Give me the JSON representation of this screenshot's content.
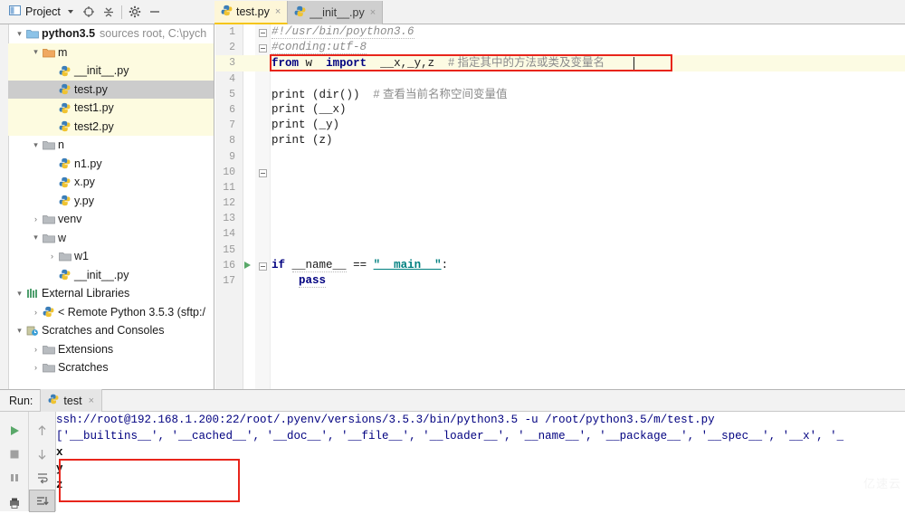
{
  "toolbar": {
    "project_label": "Project",
    "icons": [
      "target-icon",
      "collapse-all-icon",
      "gear-icon",
      "minimize-icon"
    ]
  },
  "tabs": [
    {
      "label": "test.py",
      "icon": "python-file-icon",
      "active": true,
      "close": "×"
    },
    {
      "label": "__init__.py",
      "icon": "python-file-icon",
      "active": false,
      "close": "×"
    }
  ],
  "project_tree": [
    {
      "indent": 0,
      "arrow": "▾",
      "icon": "folder-blue-icon",
      "label": "python3.5",
      "bold": true,
      "dim": "sources root, C:\\pych",
      "state": "plain"
    },
    {
      "indent": 1,
      "arrow": "▾",
      "icon": "folder-orange-icon",
      "label": "m",
      "bold": false,
      "dim": "",
      "state": "hl"
    },
    {
      "indent": 2,
      "arrow": "",
      "icon": "python-file-icon",
      "label": "__init__.py",
      "bold": false,
      "dim": "",
      "state": "hl"
    },
    {
      "indent": 2,
      "arrow": "",
      "icon": "python-file-icon",
      "label": "test.py",
      "bold": false,
      "dim": "",
      "state": "sel"
    },
    {
      "indent": 2,
      "arrow": "",
      "icon": "python-file-icon",
      "label": "test1.py",
      "bold": false,
      "dim": "",
      "state": "hl"
    },
    {
      "indent": 2,
      "arrow": "",
      "icon": "python-file-icon",
      "label": "test2.py",
      "bold": false,
      "dim": "",
      "state": "hl"
    },
    {
      "indent": 1,
      "arrow": "▾",
      "icon": "folder-gray-icon",
      "label": "n",
      "bold": false,
      "dim": "",
      "state": "plain"
    },
    {
      "indent": 2,
      "arrow": "",
      "icon": "python-file-icon",
      "label": "n1.py",
      "bold": false,
      "dim": "",
      "state": "plain"
    },
    {
      "indent": 2,
      "arrow": "",
      "icon": "python-file-icon",
      "label": "x.py",
      "bold": false,
      "dim": "",
      "state": "plain"
    },
    {
      "indent": 2,
      "arrow": "",
      "icon": "python-file-icon",
      "label": "y.py",
      "bold": false,
      "dim": "",
      "state": "plain"
    },
    {
      "indent": 1,
      "arrow": "›",
      "icon": "folder-gray-icon",
      "label": "venv",
      "bold": false,
      "dim": "",
      "state": "plain"
    },
    {
      "indent": 1,
      "arrow": "▾",
      "icon": "folder-gray-icon",
      "label": "w",
      "bold": false,
      "dim": "",
      "state": "plain"
    },
    {
      "indent": 2,
      "arrow": "›",
      "icon": "folder-gray-icon",
      "label": "w1",
      "bold": false,
      "dim": "",
      "state": "plain"
    },
    {
      "indent": 2,
      "arrow": "",
      "icon": "python-file-icon",
      "label": "__init__.py",
      "bold": false,
      "dim": "",
      "state": "plain"
    },
    {
      "indent": 0,
      "arrow": "▾",
      "icon": "external-libraries-icon",
      "label": "External Libraries",
      "bold": false,
      "dim": "",
      "state": "plain"
    },
    {
      "indent": 1,
      "arrow": "›",
      "icon": "python-interpreter-icon",
      "label": "< Remote Python 3.5.3 (sftp:/",
      "bold": false,
      "dim": "",
      "state": "plain"
    },
    {
      "indent": 0,
      "arrow": "▾",
      "icon": "scratches-icon",
      "label": "Scratches and Consoles",
      "bold": false,
      "dim": "",
      "state": "plain"
    },
    {
      "indent": 1,
      "arrow": "›",
      "icon": "folder-gray-icon",
      "label": "Extensions",
      "bold": false,
      "dim": "",
      "state": "plain"
    },
    {
      "indent": 1,
      "arrow": "›",
      "icon": "folder-gray-icon",
      "label": "Scratches",
      "bold": false,
      "dim": "",
      "state": "plain"
    }
  ],
  "code": {
    "lines": [
      {
        "n": "1",
        "type": "comment",
        "text": "#!/usr/bin/poython3.6"
      },
      {
        "n": "2",
        "type": "comment",
        "text": "#conding:utf-8"
      },
      {
        "n": "3",
        "type": "import",
        "kw1": "from",
        "mod": "w",
        "kw2": "import",
        "names": "__x,_y,z",
        "comment": "# 指定其中的方法或类及变量名"
      },
      {
        "n": "4",
        "type": "blank",
        "text": ""
      },
      {
        "n": "5",
        "type": "print",
        "text": "print (dir())",
        "comment": "# 查看当前名称空间变量值"
      },
      {
        "n": "6",
        "type": "print",
        "text": "print (__x)",
        "comment": ""
      },
      {
        "n": "7",
        "type": "print",
        "text": "print (_y)",
        "comment": ""
      },
      {
        "n": "8",
        "type": "print",
        "text": "print (z)",
        "comment": ""
      },
      {
        "n": "9",
        "type": "blank",
        "text": ""
      },
      {
        "n": "10",
        "type": "blank",
        "text": ""
      },
      {
        "n": "11",
        "type": "blank",
        "text": ""
      },
      {
        "n": "12",
        "type": "blank",
        "text": ""
      },
      {
        "n": "13",
        "type": "blank",
        "text": ""
      },
      {
        "n": "14",
        "type": "blank",
        "text": ""
      },
      {
        "n": "15",
        "type": "blank",
        "text": ""
      },
      {
        "n": "16",
        "type": "main",
        "kw": "if",
        "name": "__name__",
        "op": "==",
        "str": "\"__main__\"",
        "colon": ":"
      },
      {
        "n": "17",
        "type": "pass",
        "text": "pass"
      }
    ],
    "highlight_line": "3",
    "highlight_color": "#fcfbe3",
    "annotation_color": "#e8251b"
  },
  "run": {
    "label": "Run:",
    "tab_label": "test",
    "tab_close": "×",
    "tools": [
      "run-icon",
      "stop-icon",
      "pause-icon",
      "print-icon",
      "up-arrow-icon",
      "down-arrow-icon",
      "soft-wrap-icon",
      "scroll-to-end-icon"
    ],
    "console": [
      {
        "text": "ssh://root@192.168.1.200:22/root/.pyenv/versions/3.5.3/bin/python3.5 -u /root/python3.5/m/test.py",
        "style": "blue"
      },
      {
        "text": "['__builtins__', '__cached__', '__doc__', '__file__', '__loader__', '__name__', '__package__', '__spec__', '__x', '_",
        "style": "blue"
      },
      {
        "text": "x",
        "style": "black"
      },
      {
        "text": "y",
        "style": "black"
      },
      {
        "text": "z",
        "style": "black"
      }
    ]
  },
  "watermark": "亿速云"
}
